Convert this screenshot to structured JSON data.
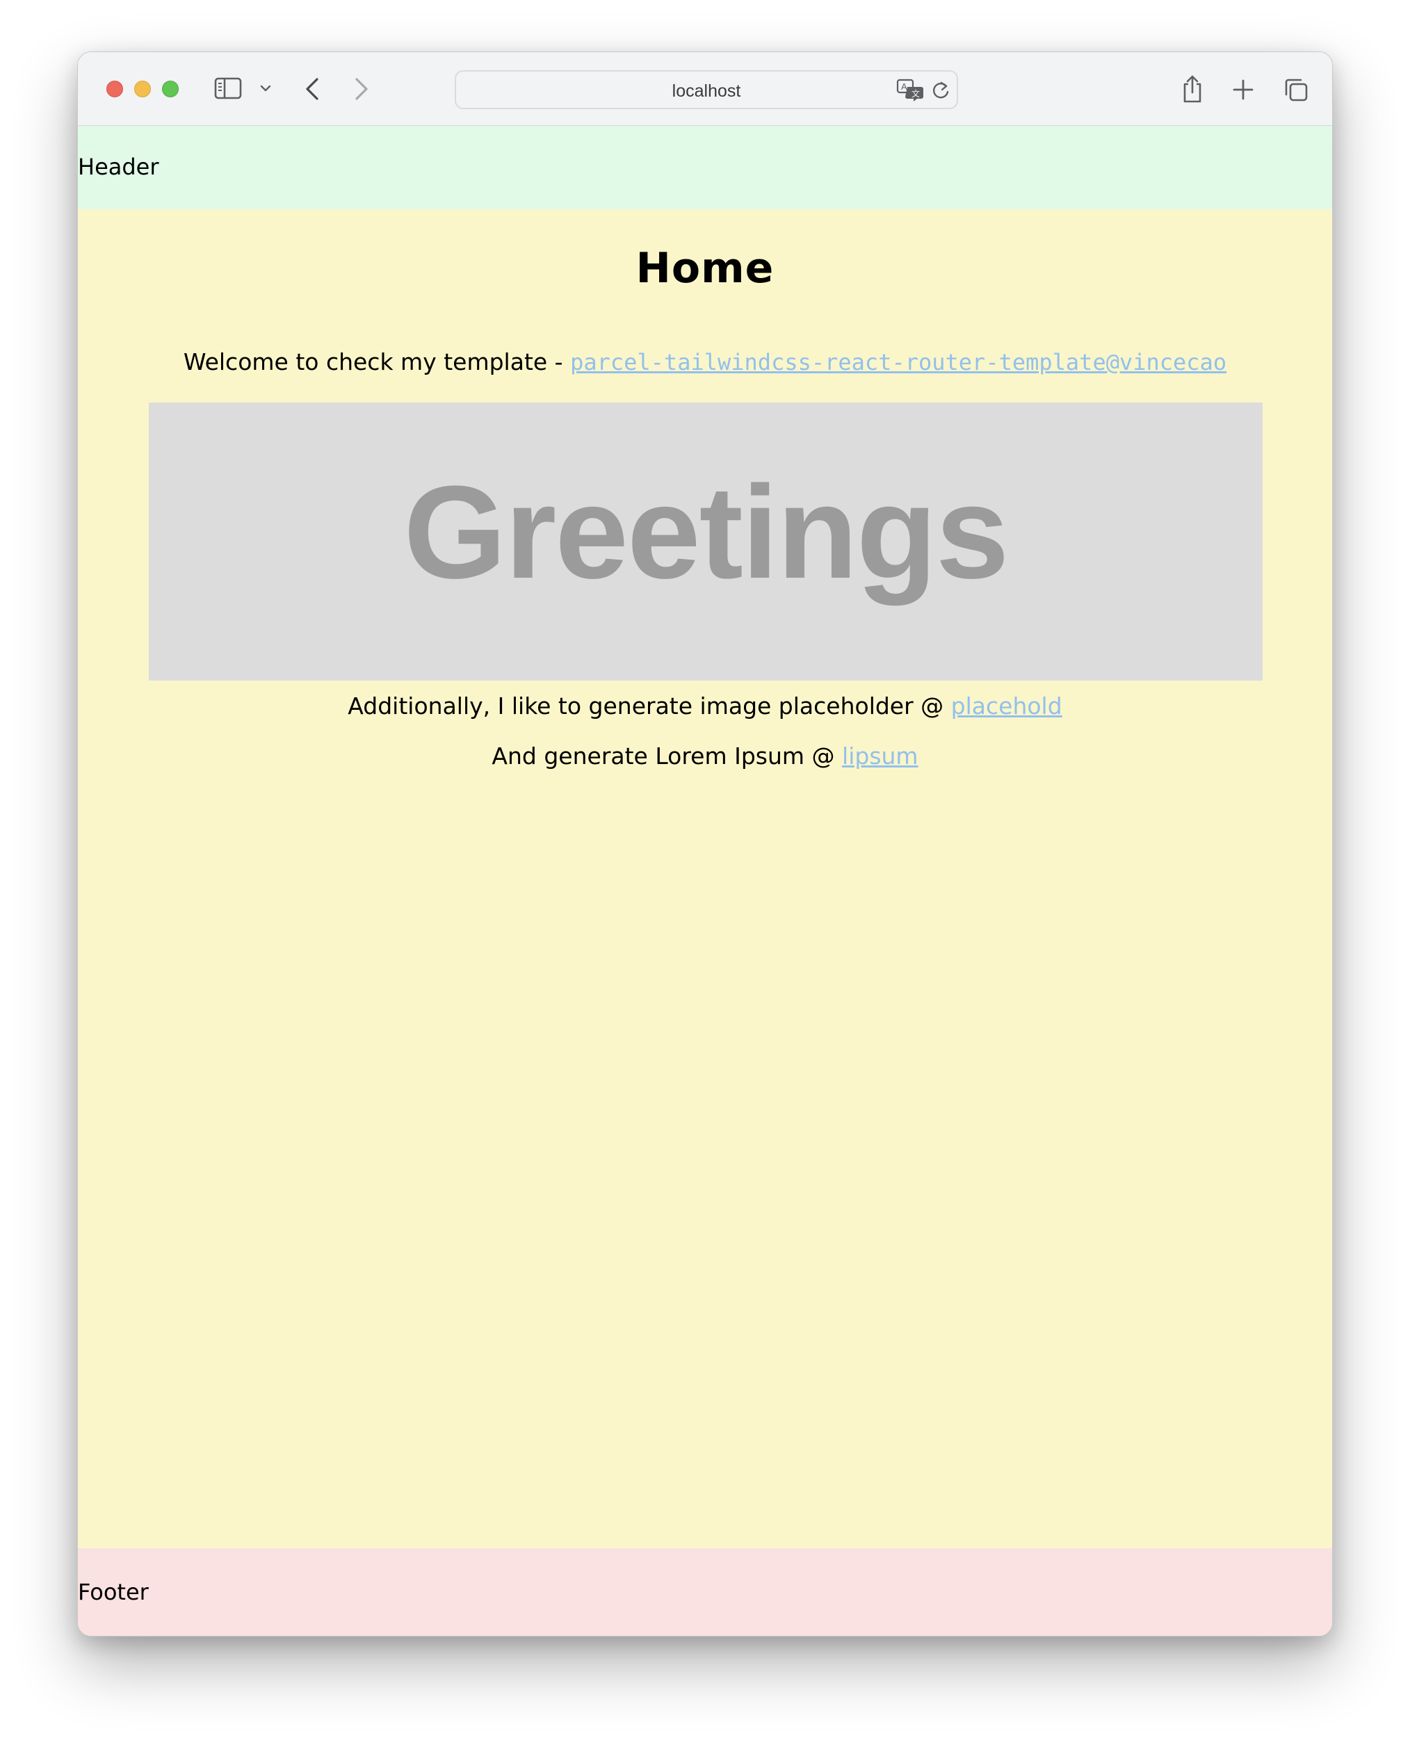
{
  "browser": {
    "address": "localhost",
    "icons": {
      "close": "close-dot",
      "minimize": "minimize-dot",
      "maximize": "maximize-dot",
      "sidebar": "sidebar-icon",
      "back": "chevron-left-icon",
      "forward": "chevron-right-icon",
      "translate": "translate-icon",
      "reload": "reload-icon",
      "share": "share-icon",
      "new_tab": "plus-icon",
      "tabs": "tabs-overview-icon"
    },
    "colors": {
      "close": "#ec6a5e",
      "minimize": "#f4be4f",
      "maximize": "#61c554",
      "toolbar_bg": "#f2f3f5"
    }
  },
  "header": {
    "label": "Header",
    "bg": "#e1f9e7"
  },
  "main": {
    "bg": "#faf6c9",
    "title": "Home",
    "welcome_text": "Welcome to check my template - ",
    "welcome_link": "parcel-tailwindcss-react-router-template@vincecao",
    "image_text": "Greetings",
    "placehold_text": "Additionally, I like to generate image placeholder @ ",
    "placehold_link": "placehold",
    "lipsum_text": "And generate Lorem Ipsum @ ",
    "lipsum_link": "lipsum",
    "link_color": "#92c0ec",
    "image_bg": "#dcdcdc",
    "image_text_color": "#9b9b9b"
  },
  "footer": {
    "label": "Footer",
    "bg": "#f9e2e1"
  }
}
